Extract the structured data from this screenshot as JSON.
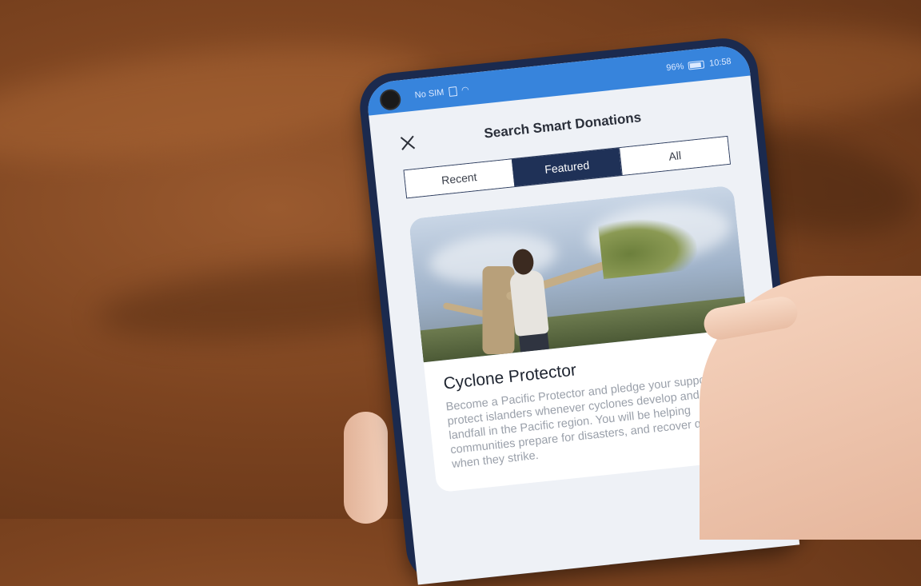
{
  "status_bar": {
    "carrier": "No SIM",
    "battery": "96%",
    "time": "10:58"
  },
  "header": {
    "title": "Search Smart Donations"
  },
  "tabs": [
    {
      "label": "Recent",
      "active": false
    },
    {
      "label": "Featured",
      "active": true
    },
    {
      "label": "All",
      "active": false
    }
  ],
  "card": {
    "title": "Cyclone Protector",
    "description": "Become a Pacific Protector and pledge your support to protect islanders whenever cyclones develop and make landfall in the Pacific region. You will be helping communities prepare for disasters, and recover quickly when they strike."
  },
  "colors": {
    "statusbar": "#3784dc",
    "active_tab": "#1f3157",
    "phone_frame": "#1b2a4e"
  },
  "icons": {
    "close": "close-icon",
    "wifi": "wifi-icon",
    "battery": "battery-icon",
    "sim": "sim-icon"
  }
}
